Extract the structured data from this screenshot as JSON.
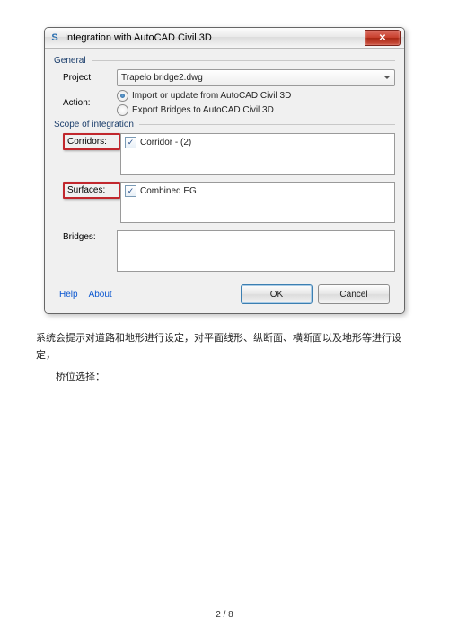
{
  "dialog": {
    "title": "Integration with AutoCAD Civil 3D",
    "general": {
      "header": "General",
      "project_label": "Project:",
      "project_value": "Trapelo bridge2.dwg",
      "action_label": "Action:",
      "radio_import": "Import or update from AutoCAD Civil 3D",
      "radio_export": "Export Bridges to AutoCAD Civil 3D"
    },
    "scope": {
      "header": "Scope of integration",
      "corridors_label": "Corridors:",
      "corridors_item": "Corridor - (2)",
      "surfaces_label": "Surfaces:",
      "surfaces_item": "Combined EG",
      "bridges_label": "Bridges:"
    },
    "footer": {
      "help": "Help",
      "about": "About",
      "ok": "OK",
      "cancel": "Cancel"
    }
  },
  "paragraph1": "系统会提示对道路和地形进行设定，对平面线形、纵断面、横断面以及地形等进行设定，",
  "paragraph2": "桥位选择：",
  "page": {
    "current": "2",
    "sep": " / ",
    "total": "8"
  }
}
